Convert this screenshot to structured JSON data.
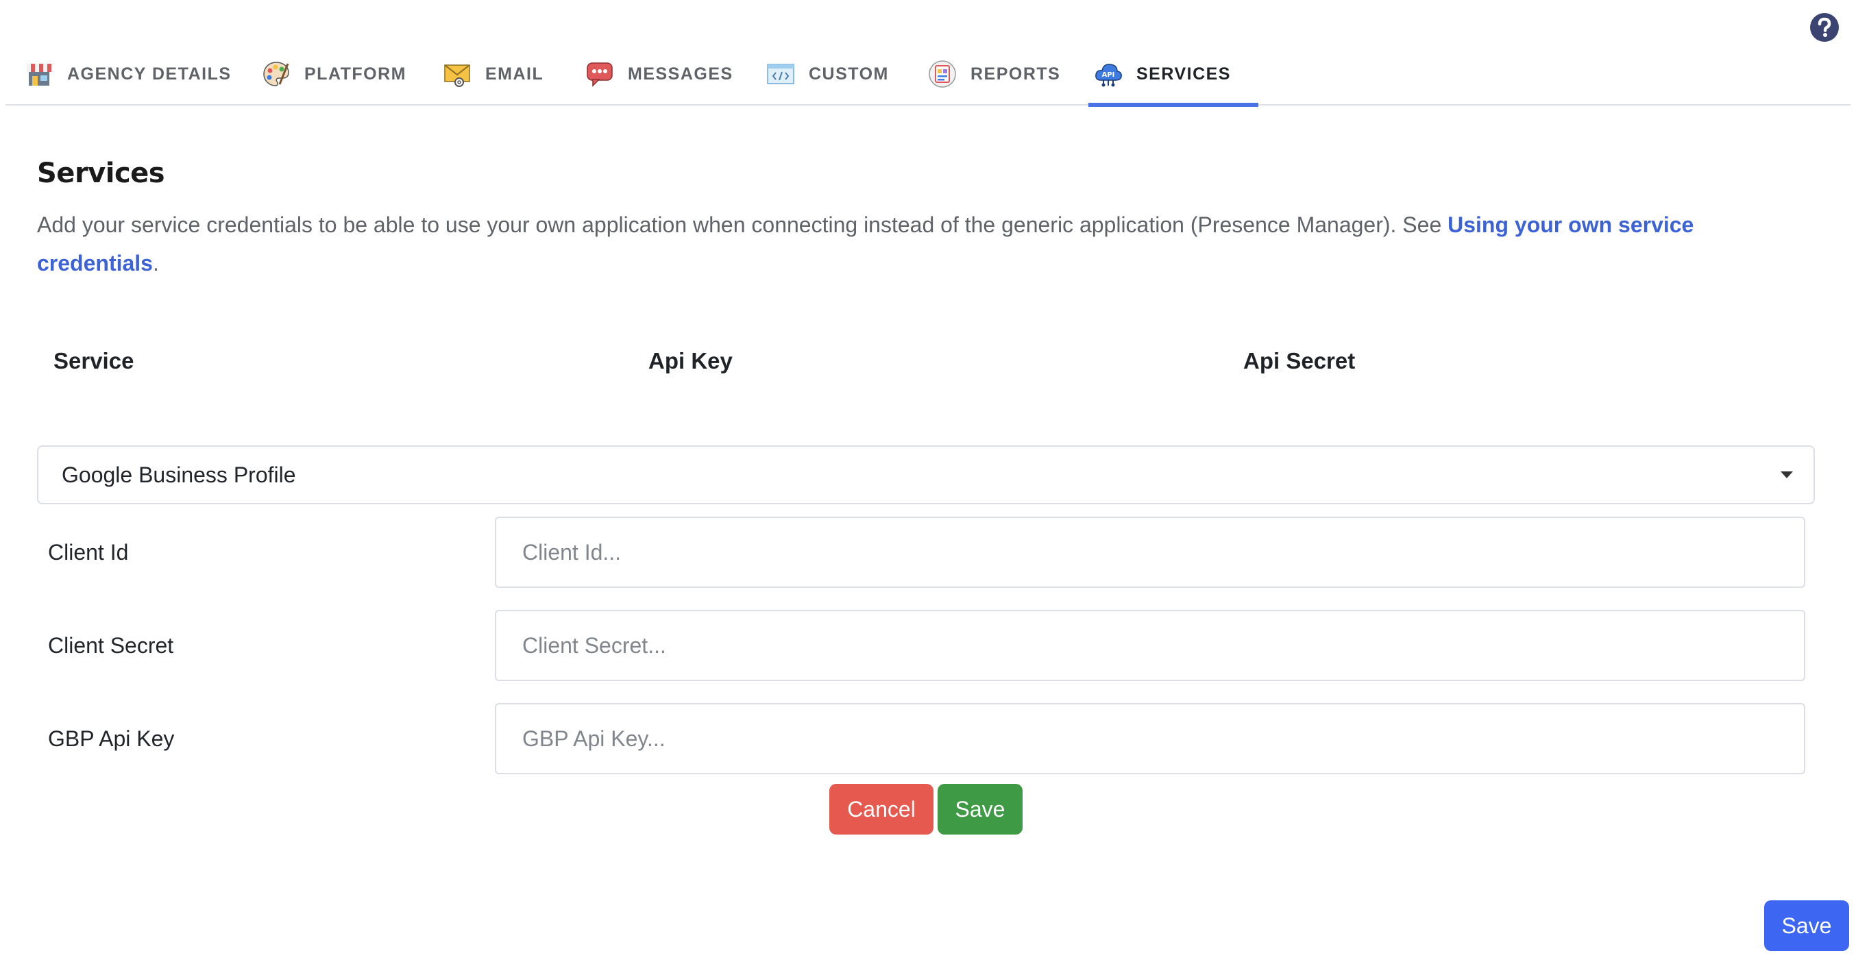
{
  "help": {
    "icon": "question-circle-icon"
  },
  "tabs": [
    {
      "label": "AGENCY DETAILS",
      "icon": "storefront-icon",
      "active": false
    },
    {
      "label": "PLATFORM",
      "icon": "palette-icon",
      "active": false
    },
    {
      "label": "EMAIL",
      "icon": "envelope-icon",
      "active": false
    },
    {
      "label": "MESSAGES",
      "icon": "chat-bubble-icon",
      "active": false
    },
    {
      "label": "CUSTOM",
      "icon": "code-window-icon",
      "active": false
    },
    {
      "label": "REPORTS",
      "icon": "report-icon",
      "active": false
    },
    {
      "label": "SERVICES",
      "icon": "api-cloud-icon",
      "active": true
    }
  ],
  "section": {
    "title": "Services",
    "description_pre": "Add your service credentials to be able to use your own application when connecting instead of the generic application (Presence Manager). See ",
    "link_text": "Using your own service credentials",
    "description_post": "."
  },
  "table": {
    "headers": [
      "Service",
      "Api Key",
      "Api Secret"
    ]
  },
  "service_select": {
    "value": "Google Business Profile"
  },
  "fields": [
    {
      "label": "Client Id",
      "placeholder": "Client Id..."
    },
    {
      "label": "Client Secret",
      "placeholder": "Client Secret..."
    },
    {
      "label": "GBP Api Key",
      "placeholder": "GBP Api Key..."
    }
  ],
  "actions": {
    "cancel_label": "Cancel",
    "save_label": "Save"
  },
  "footer": {
    "save_label": "Save"
  },
  "colors": {
    "accent": "#4a72e6",
    "link": "#3c62d6",
    "cancel": "#e5594f",
    "save": "#3e9a44",
    "primary": "#3d66f2"
  }
}
